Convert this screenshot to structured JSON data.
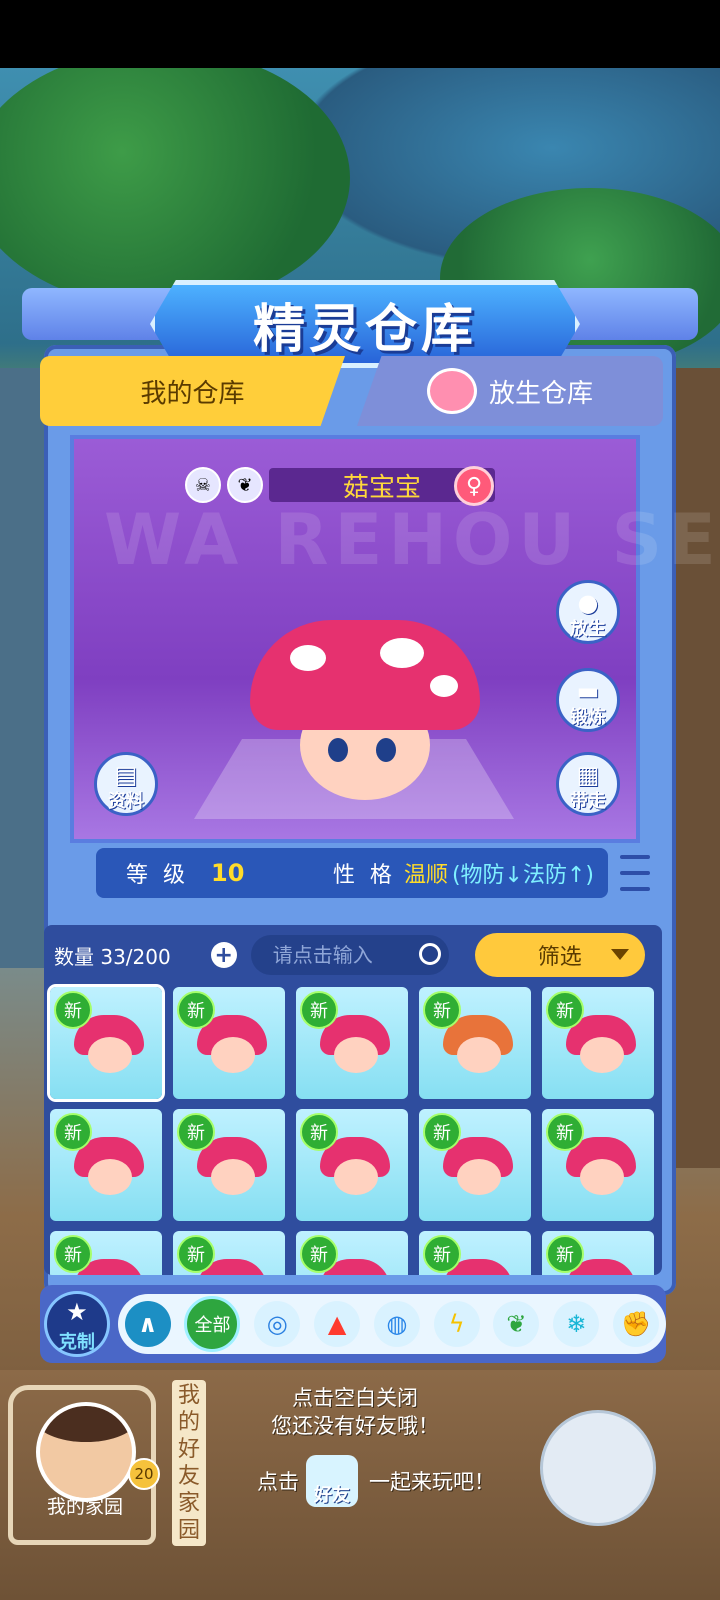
{
  "title": "精灵仓库",
  "tabs": {
    "mine": "我的仓库",
    "release": "放生仓库"
  },
  "watermark": "WA REHOU SE",
  "pet": {
    "name": "菇宝宝",
    "gender": "♀"
  },
  "side_buttons": {
    "release": "放生",
    "forge": "锻炼",
    "take": "带走",
    "info": "资料"
  },
  "stats": {
    "level_label": "等 级",
    "level": "10",
    "nature_label": "性 格",
    "nature": "温顺",
    "nature_effect": "(物防↓法防↑)"
  },
  "list": {
    "count": "数量 33/200",
    "search_placeholder": "请点击输入",
    "filter": "筛选",
    "new_badge": "新",
    "cells": [
      {
        "variant": "pink",
        "selected": true
      },
      {
        "variant": "pink"
      },
      {
        "variant": "pink"
      },
      {
        "variant": "orange"
      },
      {
        "variant": "pink"
      },
      {
        "variant": "pink"
      },
      {
        "variant": "pink"
      },
      {
        "variant": "pink"
      },
      {
        "variant": "pink"
      },
      {
        "variant": "pink"
      },
      {
        "variant": "pink"
      },
      {
        "variant": "pink"
      },
      {
        "variant": "pink"
      },
      {
        "variant": "pink"
      },
      {
        "variant": "pink"
      }
    ]
  },
  "type_bar": {
    "counter": "克制",
    "all": "全部"
  },
  "friends": {
    "home_label": "我的家园",
    "home_level": "20",
    "vertical_title": "我的好友家园",
    "line1": "点击空白关闭",
    "line2": "您还没有好友哦！",
    "click": "点击",
    "friend_badge": "好友",
    "together": "一起来玩吧！"
  }
}
